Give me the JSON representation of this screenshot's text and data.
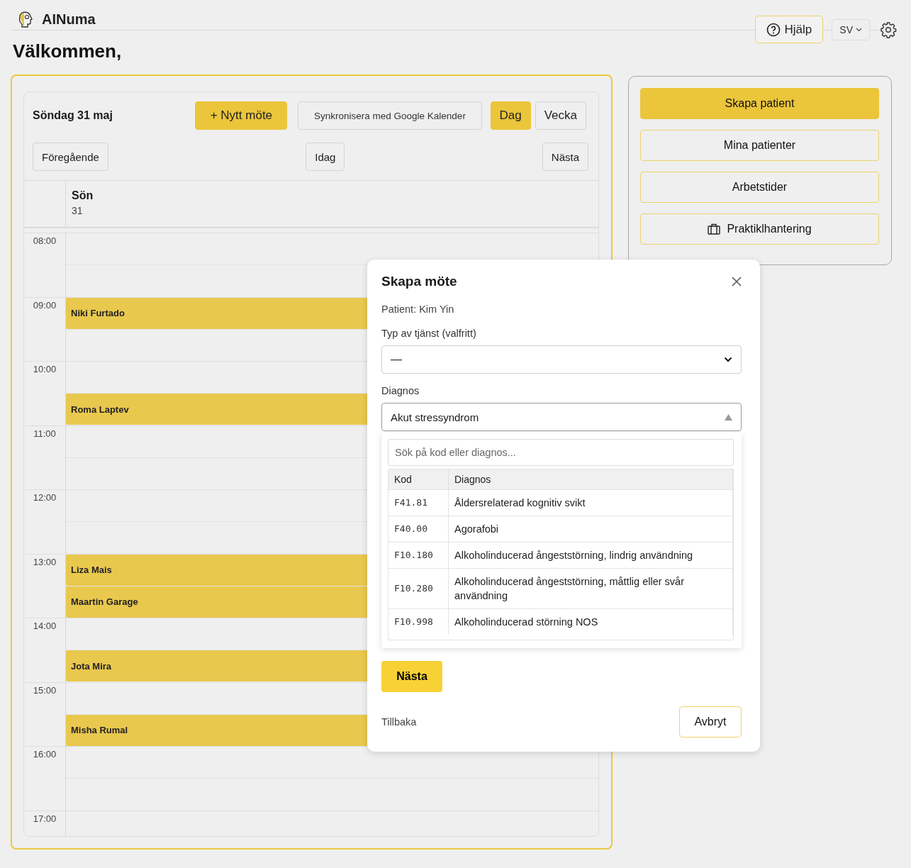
{
  "app": {
    "name": "AINuma"
  },
  "header": {
    "help_button": "Hjälp",
    "language": "SV"
  },
  "greeting": "Välkommen,",
  "calendar": {
    "date_title": "Söndag 31 maj",
    "new_meeting_button": "+ Nytt möte",
    "sync_button": "Synkronisera med Google Kalender",
    "views": [
      {
        "label": "Dag",
        "selected": true
      },
      {
        "label": "Vecka",
        "selected": false
      }
    ],
    "nav": {
      "previous": "Föregående",
      "today": "Idag",
      "next": "Nästa"
    },
    "day_header": {
      "weekday": "Sön",
      "date": "31"
    },
    "hours": [
      {
        "label": "08:00"
      },
      {
        "label": "09:00",
        "first_half": "Niki Furtado"
      },
      {
        "label": "10:00",
        "second_half": "Roma Laptev"
      },
      {
        "label": "11:00"
      },
      {
        "label": "12:00"
      },
      {
        "label": "13:00",
        "first_half": "Liza Mais",
        "second_half": "Maartin Garage"
      },
      {
        "label": "14:00",
        "second_half": "Jota Mira"
      },
      {
        "label": "15:00",
        "second_half": "Misha Rumal"
      },
      {
        "label": "16:00"
      },
      {
        "label": "17:00"
      }
    ]
  },
  "actions": [
    {
      "label": "Skapa patient",
      "kind": "primary"
    },
    {
      "label": "Mina patienter",
      "kind": "outline"
    },
    {
      "label": "Arbetstider",
      "kind": "outline"
    },
    {
      "label": "Praktiklhantering",
      "kind": "outline_icon"
    }
  ],
  "modal": {
    "title": "Skapa möte",
    "patient": "Patient: Kim Yin",
    "service_label": "Typ av tjänst (valfritt)",
    "service_value": "—",
    "diagnosis_label": "Diagnos",
    "diagnosis_value": "Akut stressyndrom",
    "expanded": true,
    "search_placeholder": "Sök på kod eller diagnos...",
    "columns": [
      "Kod",
      "Diagnos"
    ],
    "rows": [
      {
        "code": "F41.81",
        "diagnosis": "Åldersrelaterad kognitiv svikt"
      },
      {
        "code": "F40.00",
        "diagnosis": "Agorafobi"
      },
      {
        "code": "F10.180",
        "diagnosis": "Alkoholinducerad ångeststörning, lindrig användning"
      },
      {
        "code": "F10.280",
        "diagnosis": "Alkoholinducerad ångeststörning, måttlig eller svår användning"
      },
      {
        "code": "F10.998",
        "diagnosis": "Alkoholinducerad störning NOS"
      }
    ],
    "next_button": "Nästa",
    "back_link": "Tillbaka",
    "cancel_button": "Avbryt"
  }
}
